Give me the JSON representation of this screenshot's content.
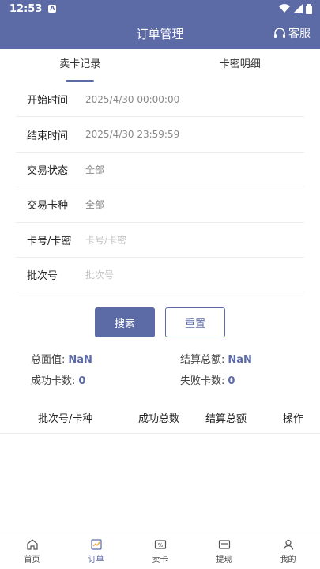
{
  "status": {
    "time": "12:53",
    "notif": "A"
  },
  "header": {
    "title": "订单管理",
    "service": "客服"
  },
  "tabs": [
    {
      "label": "卖卡记录"
    },
    {
      "label": "卡密明细"
    }
  ],
  "form": {
    "start_time": {
      "label": "开始时间",
      "value": "2025/4/30  00:00:00"
    },
    "end_time": {
      "label": "结束时间",
      "value": "2025/4/30  23:59:59"
    },
    "status": {
      "label": "交易状态",
      "value": "全部"
    },
    "card_type": {
      "label": "交易卡种",
      "value": "全部"
    },
    "card_no": {
      "label": "卡号/卡密",
      "placeholder": "卡号/卡密"
    },
    "batch": {
      "label": "批次号",
      "placeholder": "批次号"
    }
  },
  "buttons": {
    "search": "搜索",
    "reset": "重置"
  },
  "stats": {
    "total_face_label": "总面值:",
    "total_face_value": "NaN",
    "settle_total_label": "结算总额:",
    "settle_total_value": "NaN",
    "success_label": "成功卡数:",
    "success_value": "0",
    "fail_label": "失败卡数:",
    "fail_value": "0"
  },
  "table": {
    "headers": [
      "批次号/卡种",
      "成功总数",
      "结算总额",
      "操作"
    ]
  },
  "nav": [
    {
      "label": "首页"
    },
    {
      "label": "订单"
    },
    {
      "label": "卖卡"
    },
    {
      "label": "提现"
    },
    {
      "label": "我的"
    }
  ],
  "colors": {
    "accent": "#5c6aa6"
  }
}
